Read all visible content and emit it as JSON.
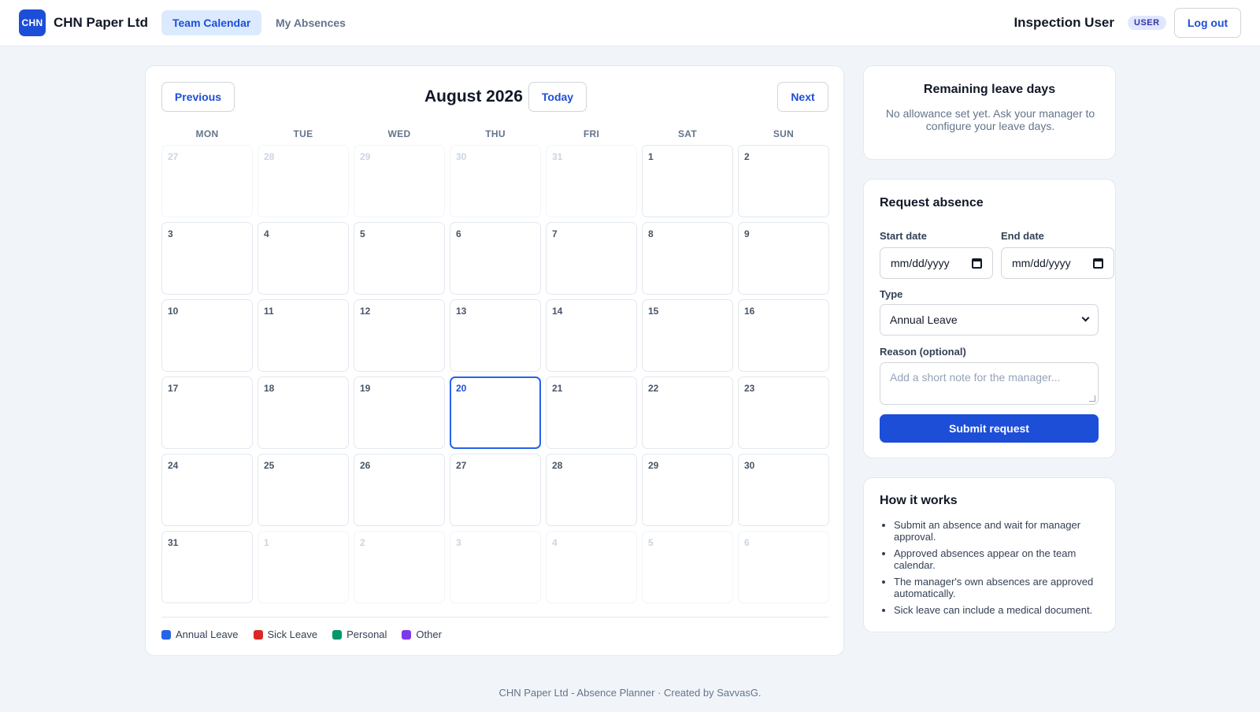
{
  "header": {
    "logo_text": "CHN",
    "brand": "CHN Paper Ltd",
    "tabs": [
      {
        "label": "Team Calendar",
        "active": true
      },
      {
        "label": "My Absences",
        "active": false
      }
    ],
    "user_name": "Inspection User",
    "role_badge": "USER",
    "logout_label": "Log out"
  },
  "calendar": {
    "prev_label": "Previous",
    "month_title": "August 2026",
    "today_label": "Today",
    "next_label": "Next",
    "weekdays": [
      "MON",
      "TUE",
      "WED",
      "THU",
      "FRI",
      "SAT",
      "SUN"
    ],
    "days": [
      {
        "n": "27",
        "muted": true
      },
      {
        "n": "28",
        "muted": true
      },
      {
        "n": "29",
        "muted": true
      },
      {
        "n": "30",
        "muted": true
      },
      {
        "n": "31",
        "muted": true
      },
      {
        "n": "1"
      },
      {
        "n": "2"
      },
      {
        "n": "3"
      },
      {
        "n": "4"
      },
      {
        "n": "5"
      },
      {
        "n": "6"
      },
      {
        "n": "7"
      },
      {
        "n": "8"
      },
      {
        "n": "9"
      },
      {
        "n": "10"
      },
      {
        "n": "11"
      },
      {
        "n": "12"
      },
      {
        "n": "13"
      },
      {
        "n": "14"
      },
      {
        "n": "15"
      },
      {
        "n": "16"
      },
      {
        "n": "17"
      },
      {
        "n": "18"
      },
      {
        "n": "19"
      },
      {
        "n": "20",
        "today": true
      },
      {
        "n": "21"
      },
      {
        "n": "22"
      },
      {
        "n": "23"
      },
      {
        "n": "24"
      },
      {
        "n": "25"
      },
      {
        "n": "26"
      },
      {
        "n": "27"
      },
      {
        "n": "28"
      },
      {
        "n": "29"
      },
      {
        "n": "30"
      },
      {
        "n": "31"
      },
      {
        "n": "1",
        "muted": true
      },
      {
        "n": "2",
        "muted": true
      },
      {
        "n": "3",
        "muted": true
      },
      {
        "n": "4",
        "muted": true
      },
      {
        "n": "5",
        "muted": true
      },
      {
        "n": "6",
        "muted": true
      }
    ],
    "legend": [
      {
        "label": "Annual Leave",
        "color": "#2563eb"
      },
      {
        "label": "Sick Leave",
        "color": "#dc2626"
      },
      {
        "label": "Personal",
        "color": "#059669"
      },
      {
        "label": "Other",
        "color": "#7c3aed"
      }
    ]
  },
  "leave": {
    "title": "Remaining leave days",
    "text": "No allowance set yet. Ask your manager to configure your leave days."
  },
  "request": {
    "title": "Request absence",
    "start_label": "Start date",
    "start_value": "mm/dd/yyyy",
    "end_label": "End date",
    "end_value": "mm/dd/yyyy",
    "type_label": "Type",
    "type_value": "Annual Leave",
    "reason_label": "Reason (optional)",
    "reason_placeholder": "Add a short note for the manager...",
    "submit_label": "Submit request"
  },
  "how": {
    "title": "How it works",
    "items": [
      "Submit an absence and wait for manager approval.",
      "Approved absences appear on the team calendar.",
      "The manager's own absences are approved automatically.",
      "Sick leave can include a medical document."
    ]
  },
  "footer": {
    "text": "CHN Paper Ltd - Absence Planner · Created by SavvasG."
  },
  "colors": {
    "accent": "#1d4ed8",
    "background": "#f1f5f9",
    "today_border": "#2563eb"
  }
}
